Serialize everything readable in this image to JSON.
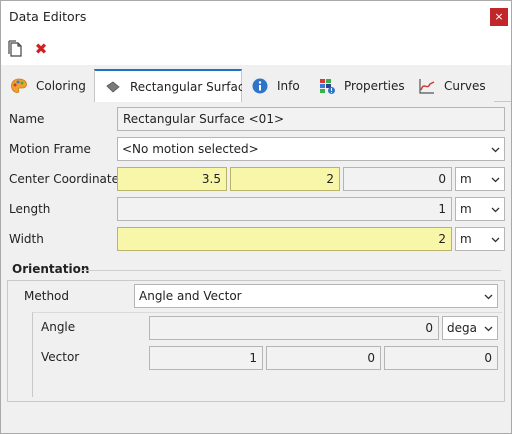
{
  "window": {
    "title": "Data Editors",
    "close_glyph": "×"
  },
  "toolbar": {
    "copy_icon": "copy-icon",
    "delete_icon": "delete-icon",
    "delete_glyph": "✖"
  },
  "tabs": [
    {
      "label": "Coloring",
      "icon": "palette-icon",
      "active": false
    },
    {
      "label": "Rectangular Surface",
      "icon": "surface-icon",
      "active": true
    },
    {
      "label": "Info",
      "icon": "info-icon",
      "active": false
    },
    {
      "label": "Properties",
      "icon": "properties-icon",
      "active": false
    },
    {
      "label": "Curves",
      "icon": "curves-icon",
      "active": false
    }
  ],
  "form": {
    "name": {
      "label": "Name",
      "value": "Rectangular Surface <01>"
    },
    "motion_frame": {
      "label": "Motion Frame",
      "value": "<No motion selected>"
    },
    "center": {
      "label": "Center Coordinates",
      "x": "3.5",
      "y": "2",
      "z": "0",
      "unit": "m"
    },
    "length": {
      "label": "Length",
      "value": "1",
      "unit": "m"
    },
    "width": {
      "label": "Width",
      "value": "2",
      "unit": "m"
    }
  },
  "orientation": {
    "title": "Orientation",
    "method": {
      "label": "Method",
      "value": "Angle and Vector"
    },
    "angle": {
      "label": "Angle",
      "value": "0",
      "unit": "dega"
    },
    "vector": {
      "label": "Vector",
      "x": "1",
      "y": "0",
      "z": "0"
    }
  },
  "colors": {
    "accent": "#1a73c9",
    "highlight_field": "#f8f6a8",
    "close_button": "#c1262b"
  }
}
